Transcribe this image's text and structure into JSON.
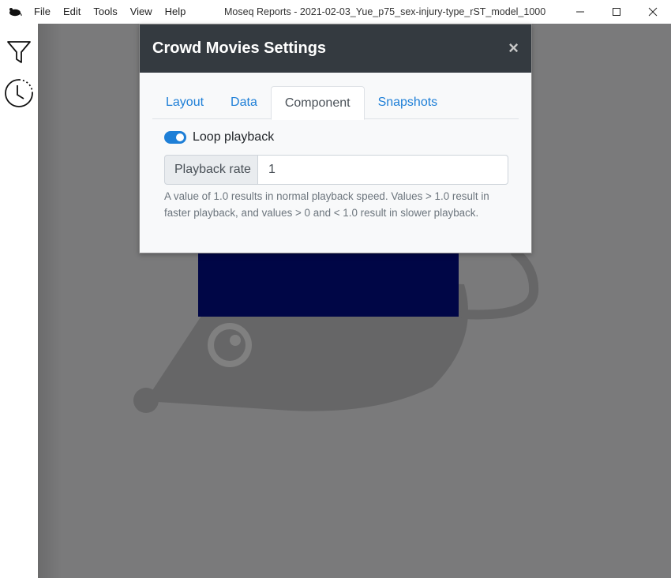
{
  "window": {
    "title": "Moseq Reports - 2021-02-03_Yue_p75_sex-injury-type_rST_model_1000",
    "menu": [
      "File",
      "Edit",
      "Tools",
      "View",
      "Help"
    ],
    "controls": {
      "minimize_icon": "minimize-icon",
      "maximize_icon": "maximize-icon",
      "close_icon": "close-icon"
    }
  },
  "rail": {
    "items": [
      {
        "icon": "filter-icon"
      },
      {
        "icon": "history-clock-icon"
      }
    ]
  },
  "modal": {
    "title": "Crowd Movies Settings",
    "close_symbol": "×",
    "tabs": [
      {
        "label": "Layout",
        "active": false
      },
      {
        "label": "Data",
        "active": false
      },
      {
        "label": "Component",
        "active": true
      },
      {
        "label": "Snapshots",
        "active": false
      }
    ],
    "loop_playback": {
      "label": "Loop playback",
      "checked": true
    },
    "playback_rate": {
      "label": "Playback rate",
      "value": "1",
      "help": "A value of 1.0 results in normal playback speed. Values > 1.0 result in faster playback, and values > 0 and < 1.0 result in slower playback."
    }
  },
  "colors": {
    "accent": "#1e7fd7",
    "modal_header": "#343a40",
    "backdrop": "#7a7a7b",
    "video_background": "#000646"
  }
}
